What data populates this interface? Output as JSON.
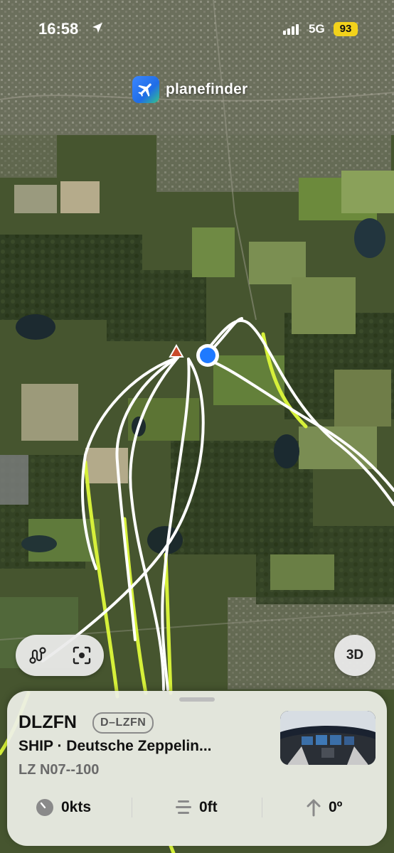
{
  "status_bar": {
    "time": "16:58",
    "network": "5G",
    "battery": "93"
  },
  "brand": {
    "name": "planefinder"
  },
  "map_controls": {
    "three_d_label": "3D"
  },
  "flight": {
    "callsign": "DLZFN",
    "registration": "D–LZFN",
    "operator": "SHIP · Deutsche Zeppelin...",
    "model": "LZ N07--100"
  },
  "stats": [
    {
      "icon": "speed-gauge-icon",
      "value": "0kts"
    },
    {
      "icon": "altitude-icon",
      "value": "0ft"
    },
    {
      "icon": "heading-arrow-icon",
      "value": "0º"
    }
  ],
  "colors": {
    "track_white": "#ffffff",
    "track_yellow": "#d6f03a",
    "brand_blue": "#2f7cf6",
    "location_blue": "#1f7aff",
    "battery": "#f2d21b"
  }
}
